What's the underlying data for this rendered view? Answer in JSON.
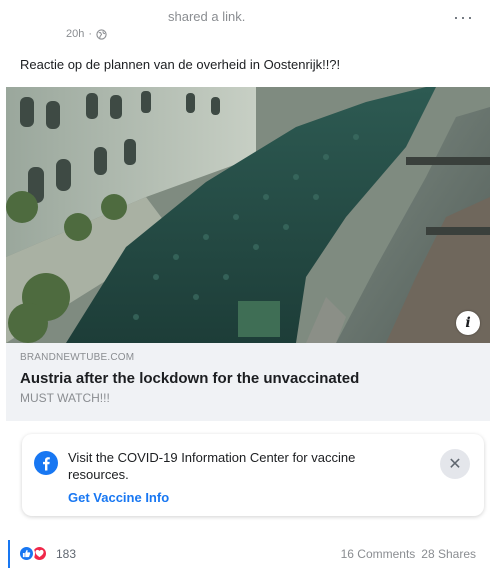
{
  "post": {
    "shared_text": "shared a link.",
    "time": "20h",
    "more_label": "···",
    "caption": "Reactie op de plannen van de overheid in Oostenrijk!!?!"
  },
  "link": {
    "domain": "BRANDNEWTUBE.COM",
    "title": "Austria after the lockdown for the unvaccinated",
    "subtitle": "MUST WATCH!!!",
    "info_label": "i"
  },
  "notice": {
    "text": "Visit the COVID-19 Information Center for vaccine resources.",
    "link_label": "Get Vaccine Info",
    "close_label": "✕"
  },
  "engagement": {
    "reaction_count": "183",
    "comments": "16 Comments",
    "shares": "28 Shares"
  },
  "colors": {
    "accent": "#1877f2",
    "love": "#f0284a",
    "muted": "#8a8d91",
    "link_bg": "#f0f2f5"
  },
  "icons": {
    "privacy": "globe-icon",
    "notice": "facebook-icon",
    "like": "thumbs-up-icon",
    "love": "heart-icon"
  }
}
